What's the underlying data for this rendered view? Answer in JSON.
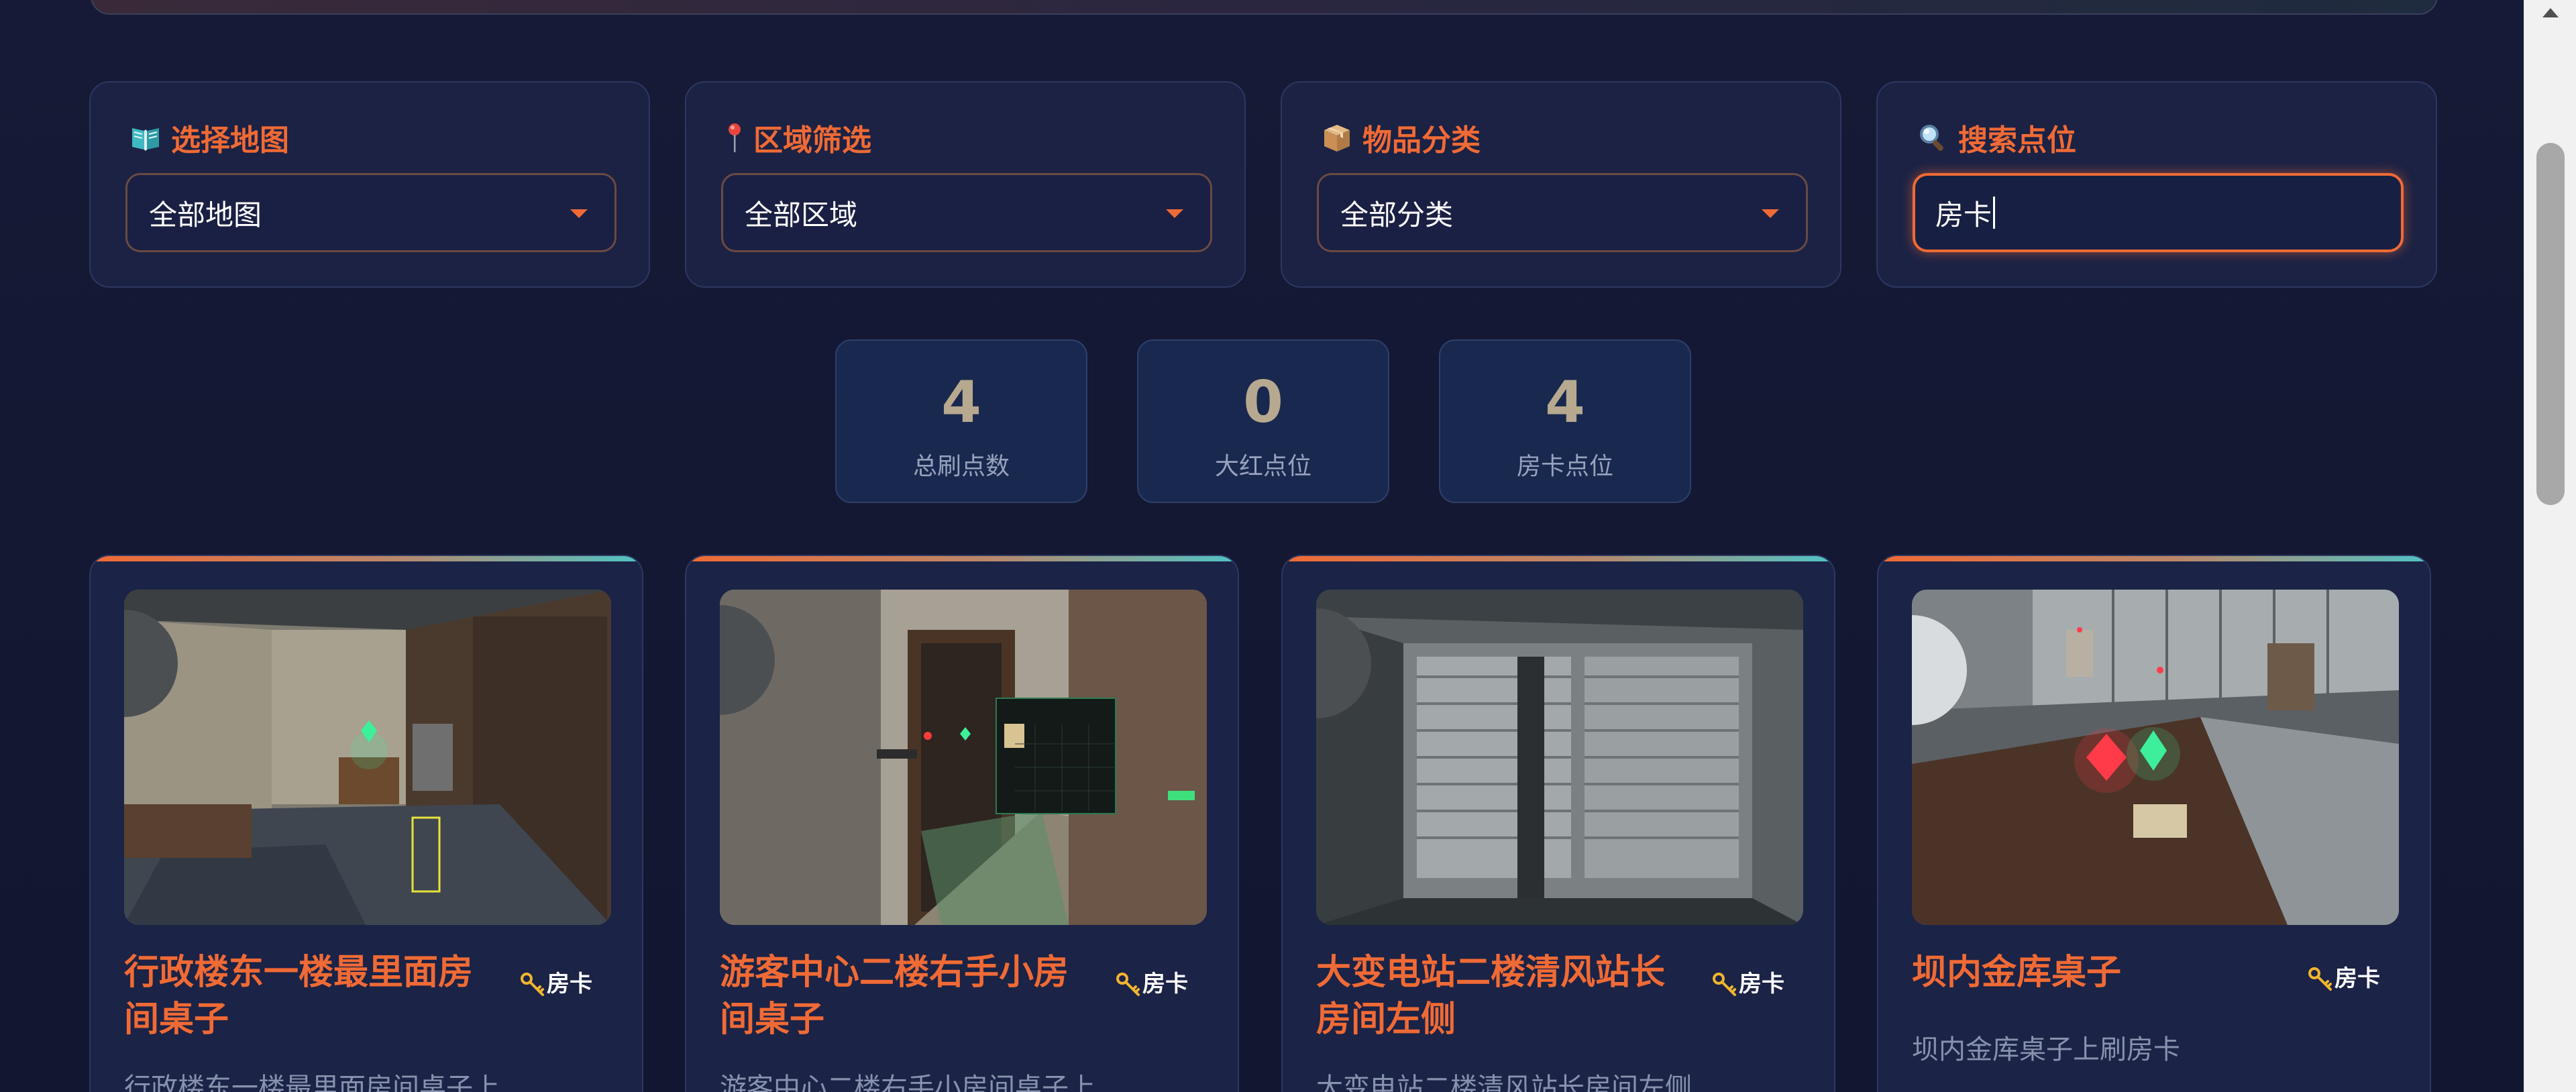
{
  "filters": {
    "map": {
      "label": "选择地图",
      "icon": "book-map-icon",
      "value": "全部地图"
    },
    "region": {
      "label": "区域筛选",
      "icon": "pushpin-icon",
      "value": "全部区域"
    },
    "category": {
      "label": "物品分类",
      "icon": "package-box-icon",
      "value": "全部分类"
    },
    "search": {
      "label": "搜索点位",
      "icon": "magnifier-icon",
      "value": "房卡"
    }
  },
  "stats": [
    {
      "value": "4",
      "label": "总刷点数"
    },
    {
      "value": "0",
      "label": "大红点位"
    },
    {
      "value": "4",
      "label": "房卡点位"
    }
  ],
  "cards": [
    {
      "title": "行政楼东一楼最里面房间桌子",
      "badge": "房卡",
      "desc": "行政楼东一楼最里面房间桌子上"
    },
    {
      "title": "游客中心二楼右手小房间桌子",
      "badge": "房卡",
      "desc": "游客中心二楼右手小房间桌子上"
    },
    {
      "title": "大变电站二楼清风站长房间左侧",
      "badge": "房卡",
      "desc": "大变电站二楼清风站长房间左侧"
    },
    {
      "title": "坝内金库桌子",
      "badge": "房卡",
      "desc": "坝内金库桌子上刷房卡"
    }
  ],
  "colors": {
    "accent": "#f06a35",
    "background": "#131631",
    "card": "#1b2346",
    "stat_number": "#b6a98f"
  }
}
